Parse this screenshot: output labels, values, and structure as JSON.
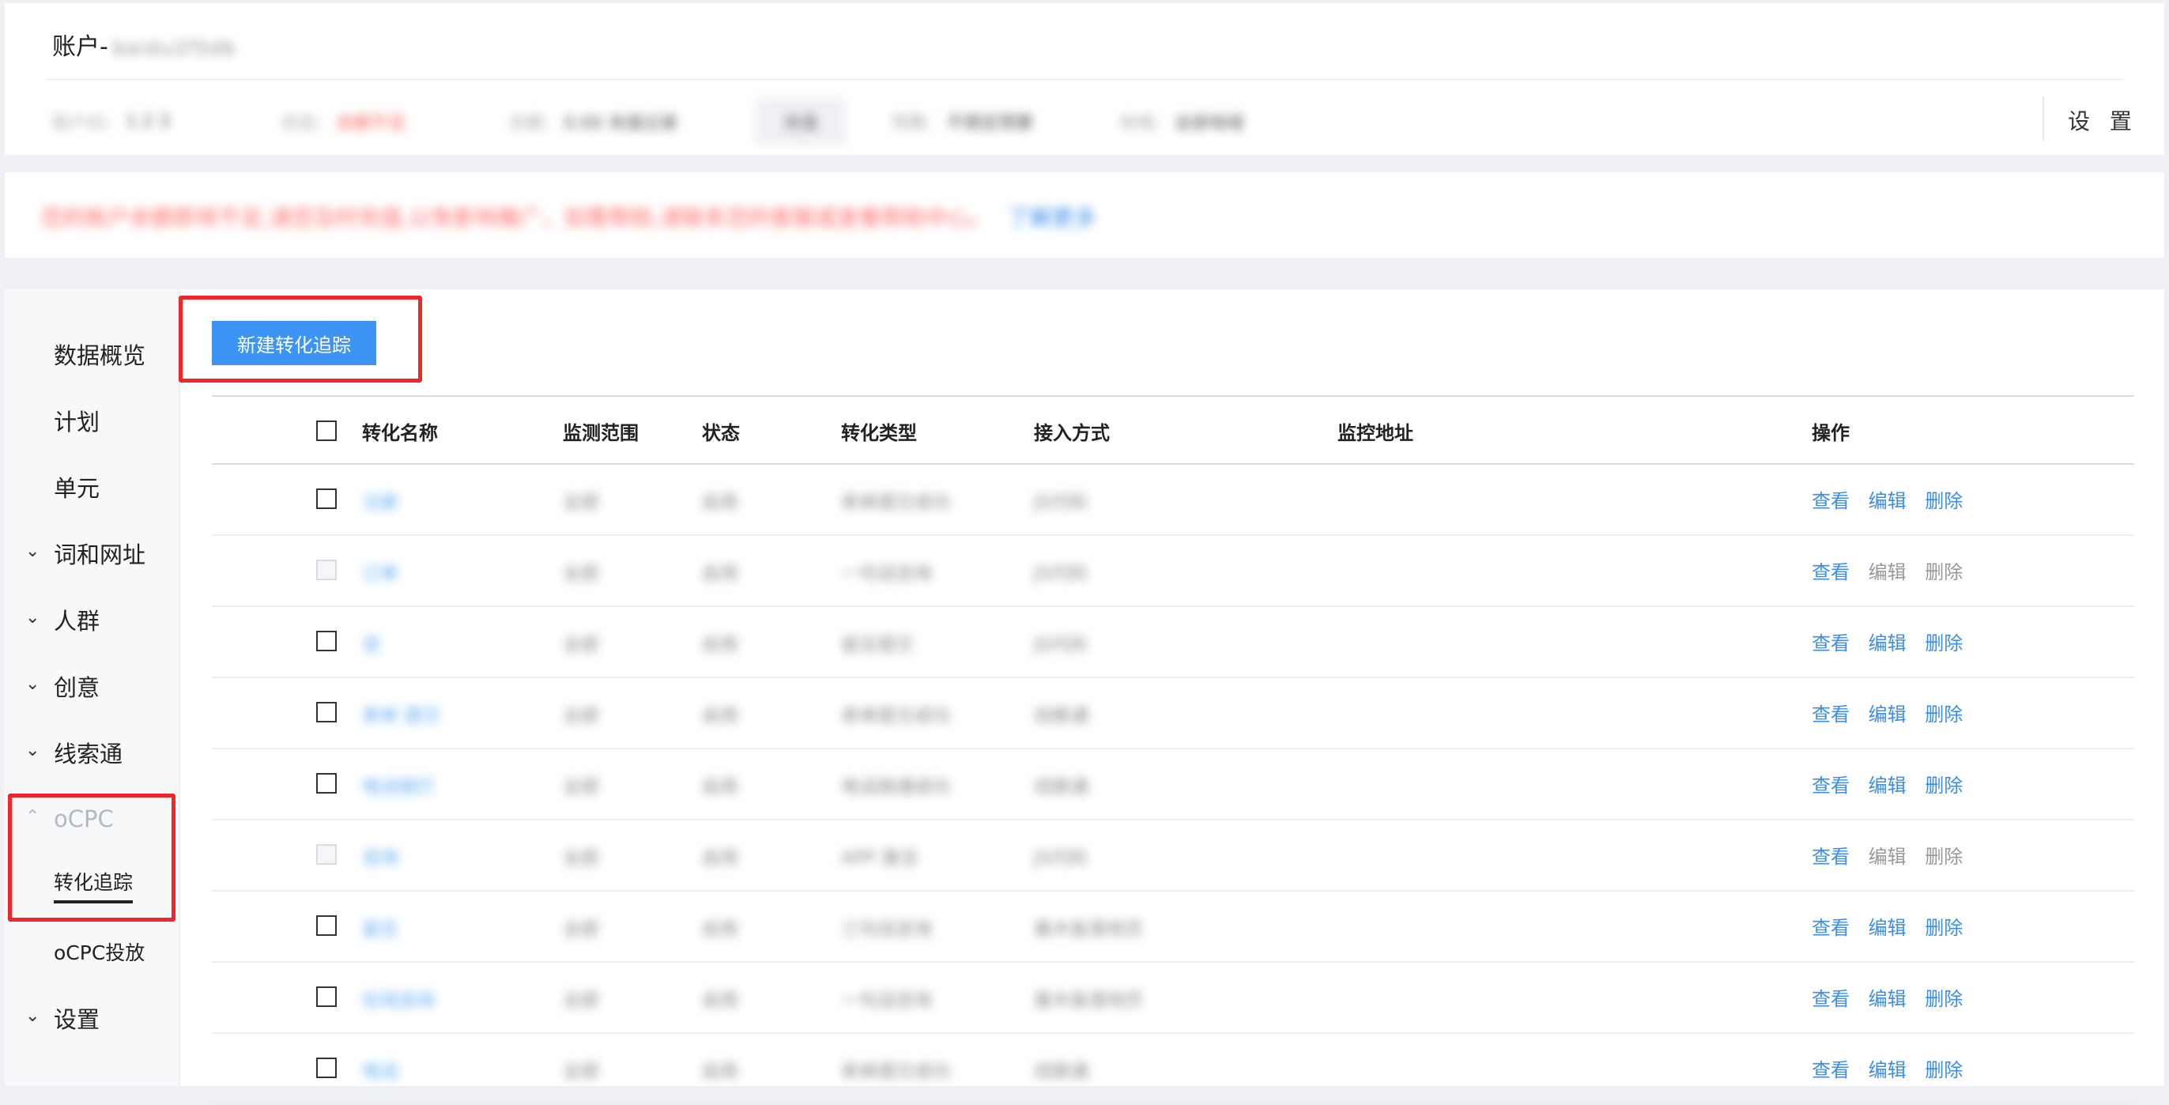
{
  "header": {
    "account_label": "账户-",
    "account_name": "baidu2f5db",
    "info": [
      {
        "label": "账户ID:",
        "value": "1 2 3"
      },
      {
        "label": "状态:",
        "value": "余额不足"
      },
      {
        "label": "余额:",
        "value": "0.00 充值记录"
      },
      {
        "label": "充值",
        "value": ""
      },
      {
        "label": "预算:",
        "value": "不限定预算"
      },
      {
        "label": "地域:",
        "value": "全部地域"
      }
    ],
    "settings_label": "设 置"
  },
  "notice": {
    "text": "您的账户余额即将不足,请您及时充值,以免影响推广。如需帮助,请联系您的客服或查看帮助中心。",
    "link": "了解更多"
  },
  "sidebar": {
    "items": [
      {
        "label": "数据概览",
        "has_chevron": false
      },
      {
        "label": "计划",
        "has_chevron": false
      },
      {
        "label": "单元",
        "has_chevron": false
      },
      {
        "label": "词和网址",
        "has_chevron": true
      },
      {
        "label": "人群",
        "has_chevron": true
      },
      {
        "label": "创意",
        "has_chevron": true
      },
      {
        "label": "线索通",
        "has_chevron": true
      },
      {
        "label": "oCPC",
        "has_chevron": true,
        "expanded": true
      },
      {
        "label": "转化追踪",
        "sub": true,
        "active": true
      },
      {
        "label": "oCPC投放",
        "sub": true
      },
      {
        "label": "设置",
        "has_chevron": true
      }
    ],
    "chevron_down": "⌄",
    "chevron_up": "⌃"
  },
  "toolbar": {
    "new_label": "新建转化追踪"
  },
  "table": {
    "columns": [
      "转化名称",
      "监测范围",
      "状态",
      "转化类型",
      "接入方式",
      "监控地址",
      "操作"
    ],
    "actions": [
      "查看",
      "编辑",
      "删除"
    ],
    "rows": [
      {
        "name": "注册",
        "scope": "全部",
        "status": "启用",
        "type": "表单提交成功",
        "method": "JS代码",
        "disabled": false
      },
      {
        "name": "订单",
        "scope": "全部",
        "status": "启用",
        "type": "一句话咨询",
        "method": "JS代码",
        "disabled": true
      },
      {
        "name": "咨",
        "scope": "全部",
        "status": "启用",
        "type": "留言提交",
        "method": "JS代码",
        "disabled": false
      },
      {
        "name": "表单 提交",
        "scope": "全部",
        "status": "启用",
        "type": "表单提交成功",
        "method": "线索通",
        "disabled": false
      },
      {
        "name": "电话拨打",
        "scope": "全部",
        "status": "启用",
        "type": "电话拨通成功",
        "method": "线索通",
        "disabled": false
      },
      {
        "name": "咨询",
        "scope": "全部",
        "status": "启用",
        "type": "APP 激活",
        "method": "JS代码",
        "disabled": true
      },
      {
        "name": "留言",
        "scope": "全部",
        "status": "启用",
        "type": "三句话咨询",
        "method": "基木鱼落地页",
        "disabled": false
      },
      {
        "name": "在线咨询",
        "scope": "全部",
        "status": "启用",
        "type": "一句话咨询",
        "method": "基木鱼落地页",
        "disabled": false
      },
      {
        "name": "电话",
        "scope": "全部",
        "status": "启用",
        "type": "表单提交成功",
        "method": "线索通",
        "disabled": false
      }
    ]
  }
}
